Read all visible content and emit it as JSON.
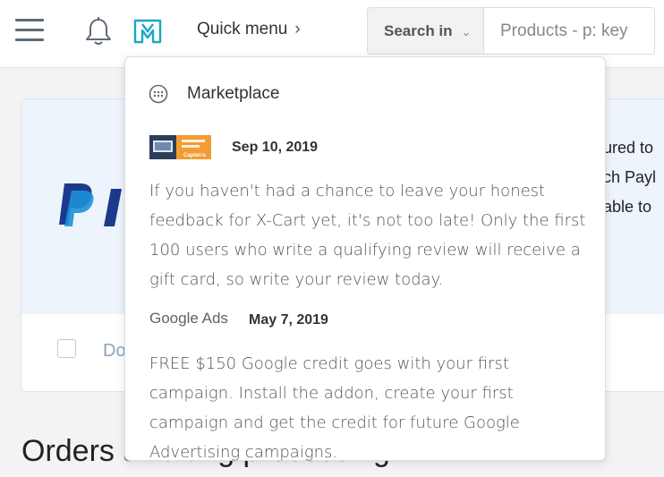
{
  "header": {
    "quick_menu_label": "Quick menu",
    "search_in_label": "Search in",
    "search_placeholder": "Products - p: key"
  },
  "background": {
    "right_text": [
      "ured to",
      "ch Payl",
      "able to"
    ],
    "do_text": "Do",
    "orders_title": "Orders awaiting processing"
  },
  "popup": {
    "title": "Marketplace",
    "items": [
      {
        "date": "Sep 10, 2019",
        "thumb_caption": "Capterra",
        "body": "If you haven't had a chance to leave your honest feedback for X-Cart yet, it's not too late! Only the first 100 users who write a qualifying review will receive a gift card, so write your review today."
      },
      {
        "date": "May 7, 2019",
        "thumb_caption": "Google Ads",
        "body": "FREE $150 Google credit goes with your first campaign. Install the addon, create your first campaign and get the credit for future Google Advertising campaigns."
      }
    ]
  },
  "colors": {
    "accent_teal": "#1aa7c9",
    "paypal_dark": "#1b3a8c",
    "paypal_light": "#1e90d8"
  }
}
